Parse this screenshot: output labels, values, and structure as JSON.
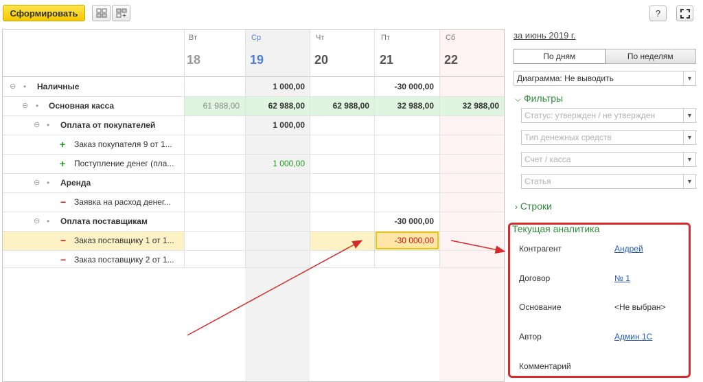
{
  "toolbar": {
    "generate_label": "Сформировать",
    "help_label": "?",
    "icon1": "collapse-groups-icon",
    "icon2": "expand-groups-icon",
    "fullscreen_icon": "fullscreen-icon"
  },
  "grid": {
    "columns": [
      {
        "wday": "Вт",
        "day": "18"
      },
      {
        "wday": "Ср",
        "day": "19"
      },
      {
        "wday": "Чт",
        "day": "20"
      },
      {
        "wday": "Пт",
        "day": "21"
      },
      {
        "wday": "Сб",
        "day": "22"
      }
    ],
    "rows": [
      {
        "label": "Наличные",
        "values": [
          "",
          "1 000,00",
          "",
          "-30 000,00",
          ""
        ]
      },
      {
        "label": "Основная касса",
        "values": [
          "61 988,00",
          "62 988,00",
          "62 988,00",
          "32 988,00",
          "32 988,00"
        ]
      },
      {
        "label": "Оплата от покупателей",
        "values": [
          "",
          "1 000,00",
          "",
          "",
          ""
        ]
      },
      {
        "label": "Заказ покупателя 9 от 1...",
        "values": [
          "",
          "",
          "",
          "",
          ""
        ]
      },
      {
        "label": "Поступление денег (пла...",
        "values": [
          "",
          "1 000,00",
          "",
          "",
          ""
        ]
      },
      {
        "label": "Аренда",
        "values": [
          "",
          "",
          "",
          "",
          ""
        ]
      },
      {
        "label": "Заявка на расход денег...",
        "values": [
          "",
          "",
          "",
          "",
          ""
        ]
      },
      {
        "label": "Оплата поставщикам",
        "values": [
          "",
          "",
          "",
          "-30 000,00",
          ""
        ]
      },
      {
        "label": "Заказ поставщику 1 от 1...",
        "values": [
          "",
          "",
          "",
          "-30 000,00",
          ""
        ]
      },
      {
        "label": "Заказ поставщику 2 от 1...",
        "values": [
          "",
          "",
          "",
          "",
          ""
        ]
      }
    ]
  },
  "panel": {
    "period": "за июнь 2019 г.",
    "tab_days": "По дням",
    "tab_weeks": "По неделям",
    "diagram": "Диаграмма: Не выводить",
    "filters_title": "Фильтры",
    "filter_status": "Статус: утвержден / не утвержден",
    "filter_money": "Тип денежных средств",
    "filter_account": "Счет / касса",
    "filter_article": "Статья",
    "rows_title": "Строки",
    "analytics_title": "Текущая аналитика",
    "fields": [
      {
        "label": "Контрагент",
        "value": "Андрей"
      },
      {
        "label": "Договор",
        "value": "№ 1"
      },
      {
        "label": "Основание",
        "value": "<Не выбран>"
      },
      {
        "label": "Автор",
        "value": "Админ 1С"
      },
      {
        "label": "Комментарий",
        "value": ""
      }
    ]
  },
  "colors": {
    "primary_button": "#f5c800",
    "highlight_row": "#fdf1c6",
    "total_row": "#dff5df",
    "green_text": "#2e8b3a",
    "red_text": "#d01010",
    "annotation_red": "#d62b2b",
    "link": "#2a5bbf"
  }
}
